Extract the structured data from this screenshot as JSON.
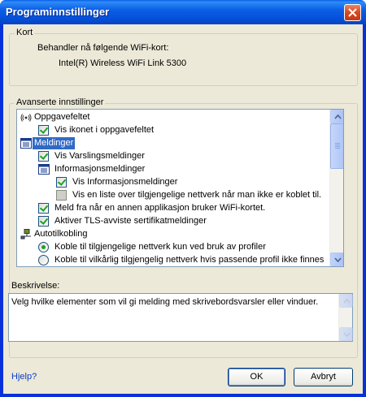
{
  "window": {
    "title": "Programinnstillinger"
  },
  "card": {
    "legend": "Kort",
    "intro": "Behandler nå følgende WiFi-kort:",
    "adapter": "Intel(R) Wireless WiFi Link 5300"
  },
  "advanced": {
    "legend": "Avanserte innstillinger",
    "items": [
      {
        "label": "Oppgavefeltet",
        "kind": "icon",
        "icon": "wifi-icon"
      },
      {
        "label": "Vis ikonet i oppgavefeltet",
        "kind": "checkbox",
        "checked": true
      },
      {
        "label": "Meldinger",
        "kind": "icon",
        "icon": "list-icon",
        "selected": true
      },
      {
        "label": "Vis Varslingsmeldinger",
        "kind": "checkbox",
        "checked": true
      },
      {
        "label": "Informasjonsmeldinger",
        "kind": "icon",
        "icon": "list-icon"
      },
      {
        "label": "Vis Informasjonsmeldinger",
        "kind": "checkbox",
        "checked": true
      },
      {
        "label": "Vis en liste over tilgjengelige nettverk når man ikke er koblet til.",
        "kind": "checkbox",
        "checked": false,
        "disabled": true
      },
      {
        "label": "Meld fra når en annen applikasjon bruker WiFi-kortet.",
        "kind": "checkbox",
        "checked": true
      },
      {
        "label": "Aktiver TLS-avviste sertifikatmeldinger",
        "kind": "checkbox",
        "checked": true
      },
      {
        "label": "Autotilkobling",
        "kind": "icon",
        "icon": "network-icon"
      },
      {
        "label": "Koble til tilgjengelige nettverk kun ved bruk av profiler",
        "kind": "radio",
        "checked": true
      },
      {
        "label": "Koble til vilkårlig tilgjengelig nettverk hvis passende profil ikke finnes",
        "kind": "radio",
        "checked": false
      }
    ]
  },
  "description": {
    "label": "Beskrivelse:",
    "text": "Velg hvilke elementer som vil gi melding med skrivebordsvarsler eller vinduer."
  },
  "footer": {
    "help": "Hjelp?",
    "ok": "OK",
    "cancel": "Avbryt"
  },
  "colors": {
    "title_bar": "#0a5fe8",
    "selection": "#316ac5",
    "dialog_bg": "#ece9d8",
    "check": "#21a121",
    "link": "#0b3bc6"
  }
}
